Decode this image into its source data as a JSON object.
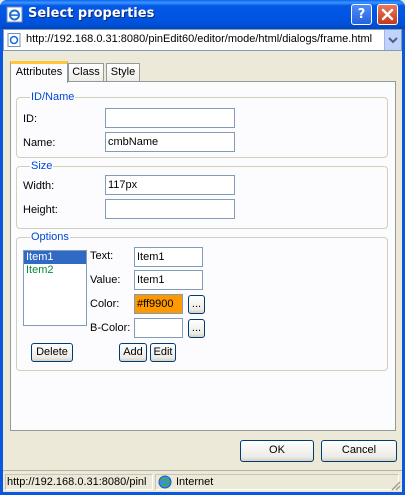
{
  "window": {
    "title": "Select properties",
    "help_glyph": "?",
    "close_icon": "close-icon"
  },
  "address": {
    "url": "http://192.168.0.31:8080/pinEdit60/editor/mode/html/dialogs/frame.html"
  },
  "tabs": [
    {
      "label": "Attributes",
      "active": true
    },
    {
      "label": "Class",
      "active": false
    },
    {
      "label": "Style",
      "active": false
    }
  ],
  "idname": {
    "legend": "ID/Name",
    "id_label": "ID:",
    "id_value": "",
    "name_label": "Name:",
    "name_value": "cmbName"
  },
  "size": {
    "legend": "Size",
    "width_label": "Width:",
    "width_value": "117px",
    "height_label": "Height:",
    "height_value": ""
  },
  "options": {
    "legend": "Options",
    "items": [
      {
        "label": "Item1",
        "selected": true,
        "color": "#ff9900"
      },
      {
        "label": "Item2",
        "selected": false,
        "color": "#0b8a3a"
      }
    ],
    "text_label": "Text:",
    "text_value": "Item1",
    "value_label": "Value:",
    "value_value": "Item1",
    "color_label": "Color:",
    "color_value": "#ff9900",
    "bcolor_label": "B-Color:",
    "bcolor_value": "",
    "browse_label": "...",
    "delete_label": "Delete",
    "add_label": "Add",
    "edit_label": "Edit"
  },
  "footer": {
    "ok_label": "OK",
    "cancel_label": "Cancel"
  },
  "status": {
    "url": "http://192.168.0.31:8080/pinl",
    "zone": "Internet"
  },
  "colors": {
    "titlebar": "#0055e5",
    "accent": "#0046d5",
    "selection": "#316ac5",
    "color_swatch": "#ff9900"
  }
}
